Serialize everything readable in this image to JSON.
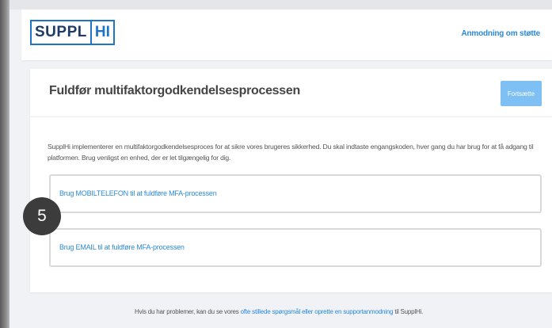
{
  "header": {
    "logo_left": "SUPPL",
    "logo_right": "HI",
    "support_link": "Anmodning om støtte"
  },
  "card": {
    "title": "Fuldfør multifaktorgodkendelsesprocessen",
    "continue_button": "Fortsætte",
    "description": "SupplHi implementerer en multifaktorgodkendelsesproces for at sikre vores brugeres sikkerhed. Du skal indtaste engangskoden, hver gang du har brug for at få adgang til platformen. Brug venligst en enhed, der er let tilgængelig for dig.",
    "options": [
      {
        "label": "Brug MOBILTELEFON til at fuldføre MFA-processen"
      },
      {
        "label": "Brug EMAIL til at fuldføre MFA-processen"
      }
    ]
  },
  "step_badge": "5",
  "footer": {
    "text_before": "Hvis du har problemer, kan du se vores ",
    "link": "ofte stillede spørgsmål eller oprette en supportanmodning",
    "text_after": " til SupplHi."
  },
  "colors": {
    "accent": "#2a8ad6",
    "button": "#7ec0f3",
    "background": "#f0f2f5",
    "logo_blue": "#1f75c4",
    "logo_dark": "#1f3c68"
  }
}
